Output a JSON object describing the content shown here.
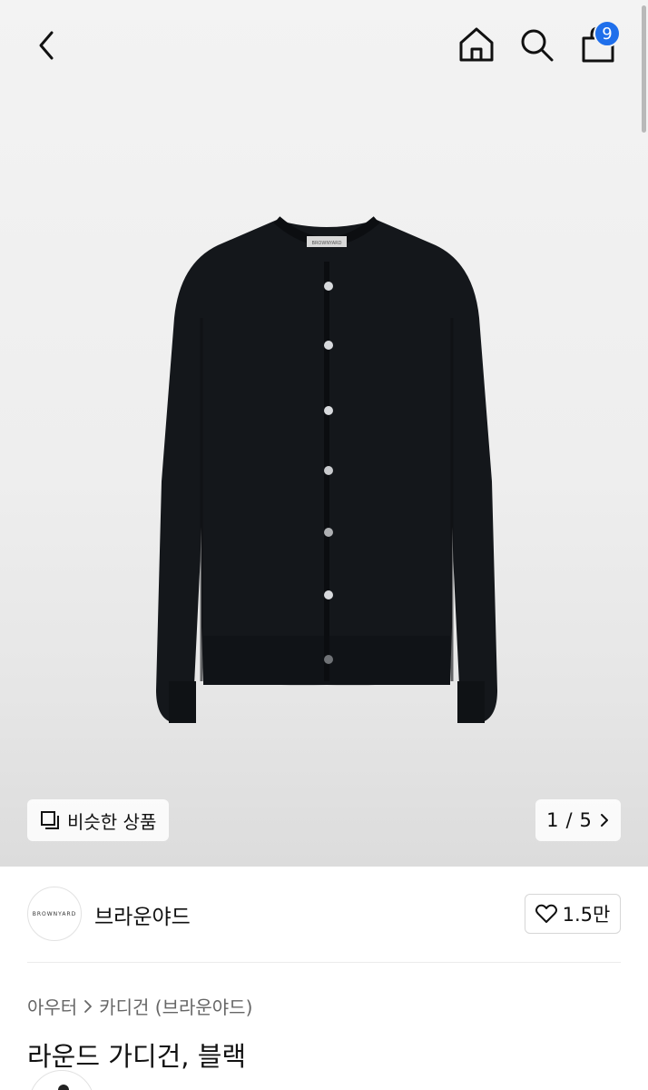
{
  "header": {
    "back_icon": "chevron-left-icon",
    "home_icon": "home-icon",
    "search_icon": "search-icon",
    "cart_icon": "shopping-bag-icon",
    "cart_count": "9",
    "badge_color": "#1f6feb"
  },
  "product_image": {
    "label_text": "BROWNYARD"
  },
  "similar_button": {
    "label": "비슷한 상품",
    "icon": "copy-icon"
  },
  "pager": {
    "current": "1",
    "separator": "/",
    "total": "5",
    "icon": "chevron-right-icon"
  },
  "brand": {
    "logo_text": "BROWNYARD",
    "name": "브라운야드",
    "like_icon": "heart-icon",
    "like_count": "1.5만"
  },
  "breadcrumb": {
    "items": [
      "아우터",
      "카디건 (브라운야드)"
    ],
    "separator_icon": "chevron-right-icon"
  },
  "product": {
    "title": "라운드 가디건, 블랙"
  }
}
